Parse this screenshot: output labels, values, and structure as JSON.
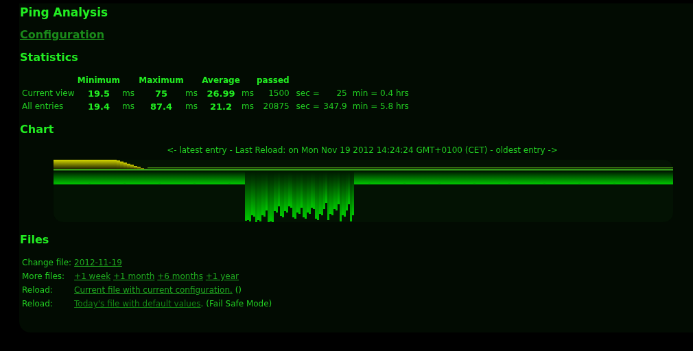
{
  "title": "Ping Analysis",
  "config_link": {
    "text": "Configuration",
    "visited": true
  },
  "statistics": {
    "heading": "Statistics",
    "columns": [
      "Minimum",
      "",
      "Maximum",
      "",
      "Average",
      "",
      "passed",
      "",
      "",
      ""
    ],
    "rows": [
      {
        "label": "Current view",
        "cells": [
          "19.5",
          "ms",
          "75",
          "ms",
          "26.99",
          "ms",
          "1500",
          "sec =",
          "25",
          "min = 0.4 hrs"
        ]
      },
      {
        "label": "All entries",
        "cells": [
          "19.4",
          "ms",
          "87.4",
          "ms",
          "21.2",
          "ms",
          "20875",
          "sec =",
          "347.9",
          "min = 5.8 hrs"
        ]
      }
    ]
  },
  "chart": {
    "heading": "Chart",
    "caption": "<- latest entry - Last Reload: on Mon Nov 19 2012 14:24:24 GMT+0100 (CET) - oldest entry ->"
  },
  "files": {
    "heading": "Files",
    "rows": [
      {
        "label": "Change file:",
        "parts": [
          {
            "kind": "link",
            "text": "2012-11-19",
            "visited": false
          }
        ]
      },
      {
        "label": "More files:",
        "parts": [
          {
            "kind": "link",
            "text": "+1 week",
            "visited": false
          },
          {
            "kind": "link",
            "text": "+1 month",
            "visited": false
          },
          {
            "kind": "link",
            "text": "+6 months",
            "visited": false
          },
          {
            "kind": "link",
            "text": "+1 year",
            "visited": false
          }
        ]
      },
      {
        "label": "Reload:",
        "parts": [
          {
            "kind": "link",
            "text": "Current file with current configuration.",
            "visited": false
          },
          {
            "kind": "text",
            "text": "()"
          }
        ]
      },
      {
        "label": "Reload:",
        "parts": [
          {
            "kind": "link",
            "text": "Today's file with default values",
            "visited": true
          },
          {
            "kind": "text",
            "text": ". (Fail Safe Mode)"
          }
        ]
      }
    ]
  }
}
